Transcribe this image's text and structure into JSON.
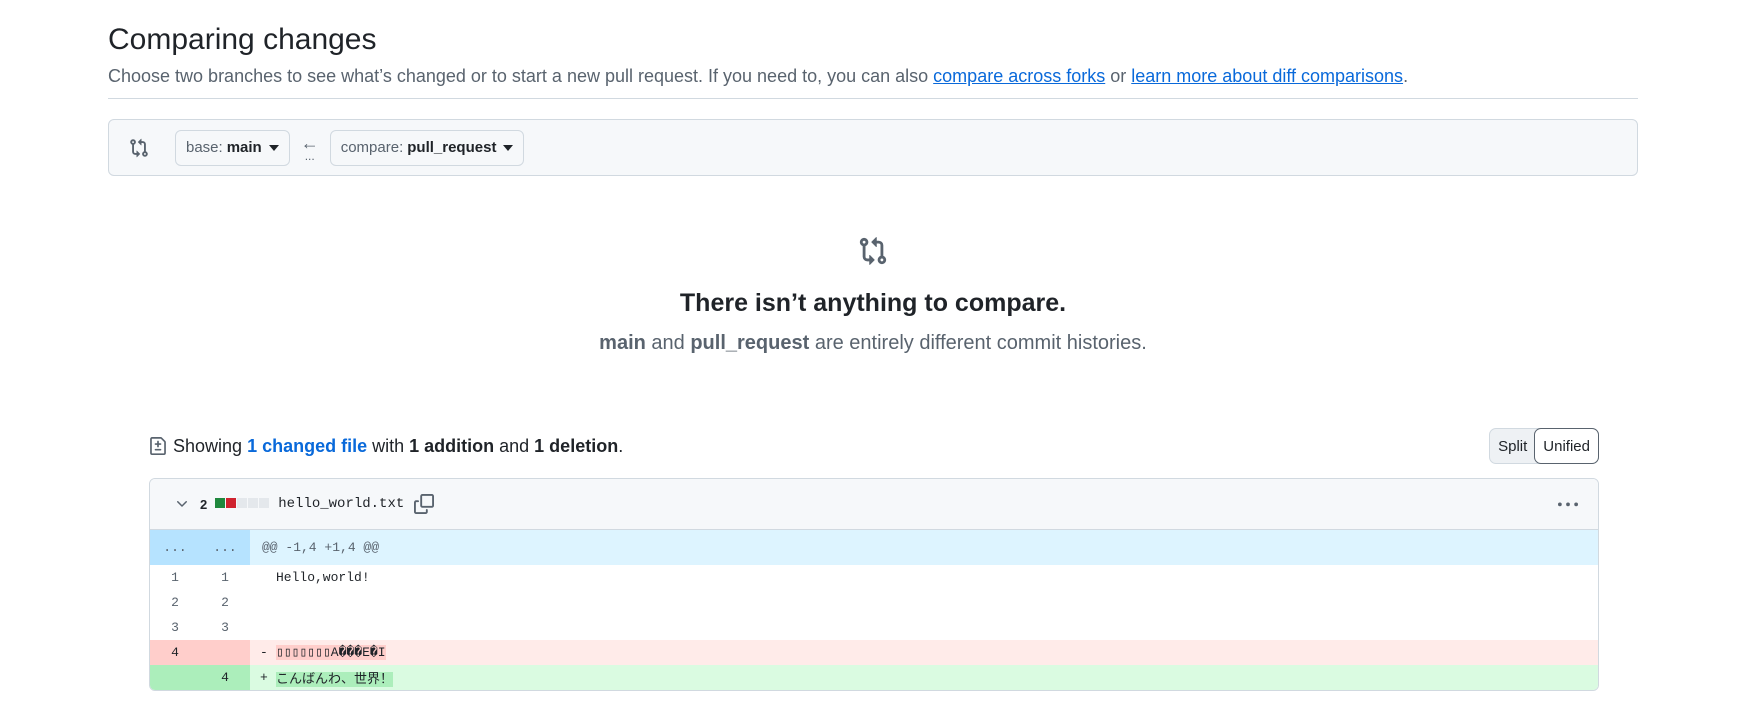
{
  "header": {
    "title": "Comparing changes",
    "subtitle_prefix": "Choose two branches to see what’s changed or to start a new pull request. If you need to, you can also ",
    "link_forks": "compare across forks",
    "subtitle_mid": " or ",
    "link_learn": "learn more about diff comparisons",
    "subtitle_suffix": "."
  },
  "range": {
    "base_label": "base:",
    "base_value": "main",
    "arrow": "←",
    "dots": "...",
    "compare_label": "compare:",
    "compare_value": "pull_request"
  },
  "blankslate": {
    "title": "There isn’t anything to compare.",
    "branch_a": "main",
    "and": " and ",
    "branch_b": "pull_request",
    "rest": " are entirely different commit histories."
  },
  "toc": {
    "showing": "Showing ",
    "changed_files": "1 changed file",
    "with": " with ",
    "additions": "1 addition",
    "and": " and ",
    "deletions": "1 deletion",
    "period": ".",
    "split_label": "Split",
    "unified_label": "Unified",
    "active_view": "Unified"
  },
  "file": {
    "changes": "2",
    "filename": "hello_world.txt",
    "diffstat_colors": [
      "#1f883d",
      "#cf222e",
      "#e4e8ec",
      "#e4e8ec",
      "#e4e8ec"
    ],
    "hunk": {
      "left": "...",
      "right": "...",
      "header": "@@ -1,4 +1,4 @@"
    },
    "lines": [
      {
        "type": "context",
        "old": "1",
        "new": "1",
        "marker": "",
        "text": "Hello,world!"
      },
      {
        "type": "context",
        "old": "2",
        "new": "2",
        "marker": "",
        "text": ""
      },
      {
        "type": "context",
        "old": "3",
        "new": "3",
        "marker": "",
        "text": ""
      },
      {
        "type": "del",
        "old": "4",
        "new": "",
        "marker": "-",
        "text": "▯▯▯▯▯▯▯A���E�I"
      },
      {
        "type": "add",
        "old": "",
        "new": "4",
        "marker": "+",
        "text": "こんばんわ、世界！"
      }
    ]
  },
  "colors": {
    "accent": "#0969da",
    "addition": "#1f883d",
    "deletion": "#cf222e"
  }
}
